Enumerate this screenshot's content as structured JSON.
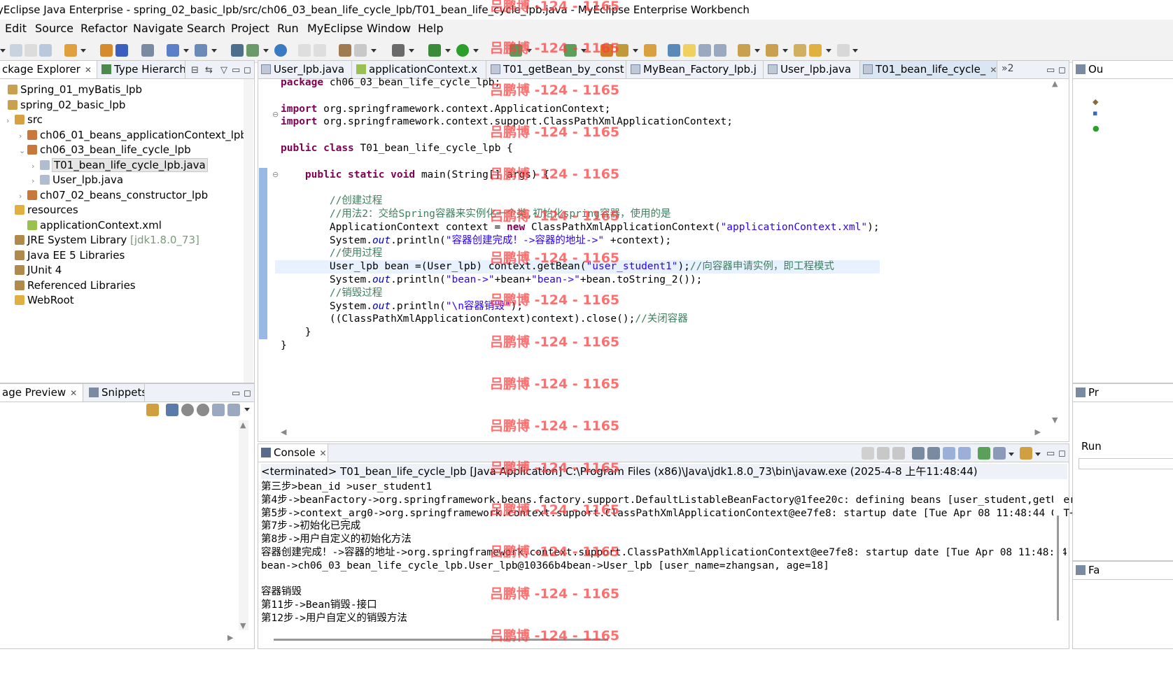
{
  "window": {
    "title": "yEclipse Java Enterprise - spring_02_basic_lpb/src/ch06_03_bean_life_cycle_lpb/T01_bean_life_cycle_lpb.java - MyEclipse Enterprise Workbench"
  },
  "menu": [
    {
      "label": "Edit"
    },
    {
      "label": "Source"
    },
    {
      "label": "Refactor"
    },
    {
      "label": "Navigate"
    },
    {
      "label": "Search"
    },
    {
      "label": "Project"
    },
    {
      "label": "Run"
    },
    {
      "label": "MyEclipse"
    },
    {
      "label": "Window"
    },
    {
      "label": "Help"
    }
  ],
  "explorer": {
    "tabs": [
      {
        "label": "ckage Explorer",
        "icon": "package-explorer-icon"
      },
      {
        "label": "Type Hierarchy",
        "icon": "type-hierarchy-icon"
      }
    ],
    "tree": [
      {
        "label": "Spring_01_myBatis_lpb",
        "indent": 0,
        "icon": "project-icon",
        "muted": ""
      },
      {
        "label": "spring_02_basic_lpb",
        "indent": 0,
        "icon": "project-icon",
        "muted": ""
      },
      {
        "label": "src",
        "indent": 1,
        "icon": "source-folder-icon",
        "muted": ""
      },
      {
        "label": "ch06_01_beans_applicationContext_lpb",
        "indent": 2,
        "icon": "package-icon",
        "muted": ""
      },
      {
        "label": "ch06_03_bean_life_cycle_lpb",
        "indent": 2,
        "icon": "package-icon",
        "muted": ""
      },
      {
        "label": "T01_bean_life_cycle_lpb.java",
        "indent": 3,
        "icon": "java-file-icon",
        "muted": "",
        "selected": true
      },
      {
        "label": "User_lpb.java",
        "indent": 3,
        "icon": "java-file-icon",
        "muted": ""
      },
      {
        "label": "ch07_02_beans_constructor_lpb",
        "indent": 2,
        "icon": "package-icon",
        "muted": ""
      },
      {
        "label": "resources",
        "indent": 1,
        "icon": "folder-icon",
        "muted": ""
      },
      {
        "label": "applicationContext.xml",
        "indent": 2,
        "icon": "xml-file-icon",
        "muted": ""
      },
      {
        "label": "JRE System Library",
        "indent": 1,
        "icon": "library-icon",
        "muted": "[jdk1.8.0_73]"
      },
      {
        "label": "Java EE 5 Libraries",
        "indent": 1,
        "icon": "library-icon",
        "muted": ""
      },
      {
        "label": "JUnit 4",
        "indent": 1,
        "icon": "library-icon",
        "muted": ""
      },
      {
        "label": "Referenced Libraries",
        "indent": 1,
        "icon": "library-icon",
        "muted": ""
      },
      {
        "label": "WebRoot",
        "indent": 1,
        "icon": "folder-icon",
        "muted": ""
      }
    ]
  },
  "preview": {
    "tabs": [
      {
        "label": "age Preview",
        "icon": "image-preview-icon"
      },
      {
        "label": "Snippets",
        "icon": "snippets-icon"
      }
    ]
  },
  "editor": {
    "tabs": [
      {
        "label": "User_lpb.java",
        "icon": "java-file-icon"
      },
      {
        "label": "applicationContext.x",
        "icon": "xml-file-icon"
      },
      {
        "label": "T01_getBean_by_const",
        "icon": "java-file-icon"
      },
      {
        "label": "MyBean_Factory_lpb.j",
        "icon": "java-file-icon"
      },
      {
        "label": "User_lpb.java",
        "icon": "java-file-icon"
      },
      {
        "label": "T01_bean_life_cycle_",
        "icon": "java-file-icon",
        "active": true
      }
    ],
    "overflow": "»2",
    "code": [
      "package ch06_03_bean_life_cycle_lpb;",
      "",
      "import org.springframework.context.ApplicationContext;",
      "import org.springframework.context.support.ClassPathXmlApplicationContext;",
      "",
      "public class T01_bean_life_cycle_lpb {",
      "",
      "    public static void main(String[] args) {",
      "",
      "        //创建过程",
      "        //用法2：交给Spring容器来实例化一个类,初始化spring容器，使用的是",
      "        ApplicationContext context = new ClassPathXmlApplicationContext(\"applicationContext.xml\");",
      "        System.out.println(\"容器创建完成！->容器的地址->\" +context);",
      "        //使用过程",
      "        User_lpb bean =(User_lpb) context.getBean(\"user_student1\");//向容器申请实例，即工程模式",
      "        System.out.println(\"bean->\"+bean+\"bean->\"+bean.toString_2());",
      "        //销毁过程",
      "        System.out.println(\"\\n容器销毁\");",
      "        ((ClassPathXmlApplicationContext)context).close();//关闭容器",
      "    }",
      "}"
    ]
  },
  "console": {
    "tab_label": "Console",
    "header": "<terminated> T01_bean_life_cycle_lpb [Java Application] C:\\Program Files (x86)\\Java\\jdk1.8.0_73\\bin\\javaw.exe (2025-4-8 上午11:48:44)",
    "lines": [
      "第三步>bean_id >user_student1",
      "第4步->beanFactory->org.springframework.beans.factory.support.DefaultListableBeanFactory@1fee20c: defining beans [user_student,getUserB",
      "第5步->context_arg0->org.springframework.context.support.ClassPathXmlApplicationContext@ee7fe8: startup date [Tue Apr 08 11:48:44 GMT+0",
      "第7步->初始化已完成",
      "第8步->用户自定义的初始化方法",
      "容器创建完成！->容器的地址->org.springframework.context.support.ClassPathXmlApplicationContext@ee7fe8: startup date [Tue Apr 08 11:48:44",
      "bean->ch06_03_bean_life_cycle_lpb.User_lpb@10366b4bean->User_lpb [user_name=zhangsan, age=18]",
      "",
      "容器销毁",
      "第11步->Bean销毁-接口",
      "第12步->用户自定义的销毁方法"
    ]
  },
  "right_panels": {
    "outline_label": "Ou",
    "properties_label": "Pr",
    "run_label": "Run",
    "bottom_label": "Fa"
  },
  "watermark": "吕鹏博 -124 - 1165",
  "colors": {
    "keyword": "#7f0055",
    "string": "#2a00ff",
    "comment": "#3f7f5f",
    "field": "#0000c0",
    "watermark": "#ff4040",
    "tab_bar": "#eef2f8"
  }
}
